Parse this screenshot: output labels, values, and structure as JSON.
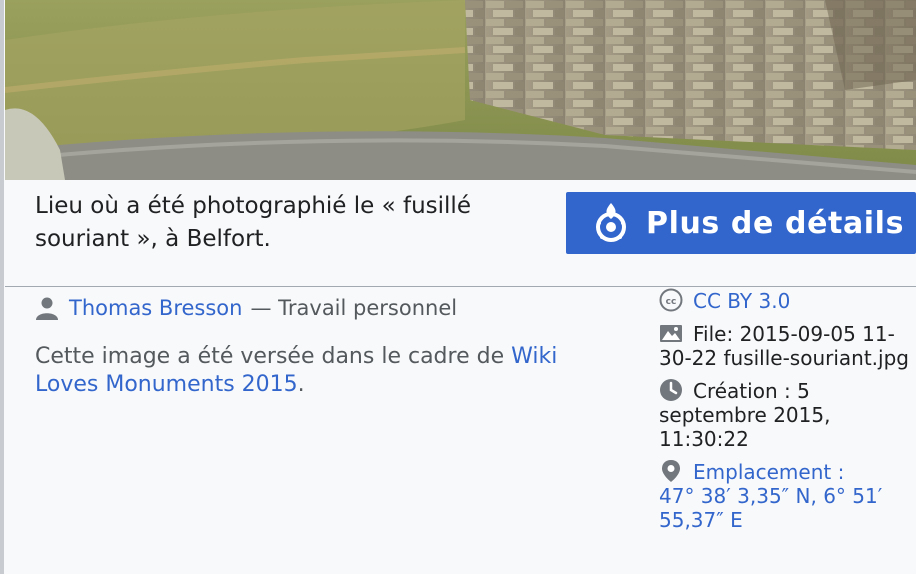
{
  "caption": {
    "text": "Lieu où a été photographié le «  fusillé souriant  », à Belfort."
  },
  "details_button": {
    "label": "Plus de détails"
  },
  "author": {
    "name": "Thomas Bresson",
    "suffix": "— Travail personnel"
  },
  "campaign": {
    "prefix": "Cette image a été versée dans le cadre de ",
    "link": "Wiki Loves Monuments 2015",
    "suffix": "."
  },
  "meta": {
    "license": "CC BY 3.0",
    "file": "File: 2015-09-05 11-30-22 fusille-souriant.jpg",
    "created": "Création : 5 septembre 2015, 11:30:22",
    "location_label": "Emplacement :",
    "coordinates": "47° 38′ 3,35″ N, 6° 51′ 55,37″ E"
  },
  "colors": {
    "link": "#3366cc",
    "button": "#3366cc",
    "text": "#202122",
    "muted": "#54595d",
    "background": "#f8f9fa"
  },
  "icons": [
    "commons-logo-icon",
    "user-icon",
    "cc-license-icon",
    "image-file-icon",
    "clock-icon",
    "map-pin-icon"
  ]
}
